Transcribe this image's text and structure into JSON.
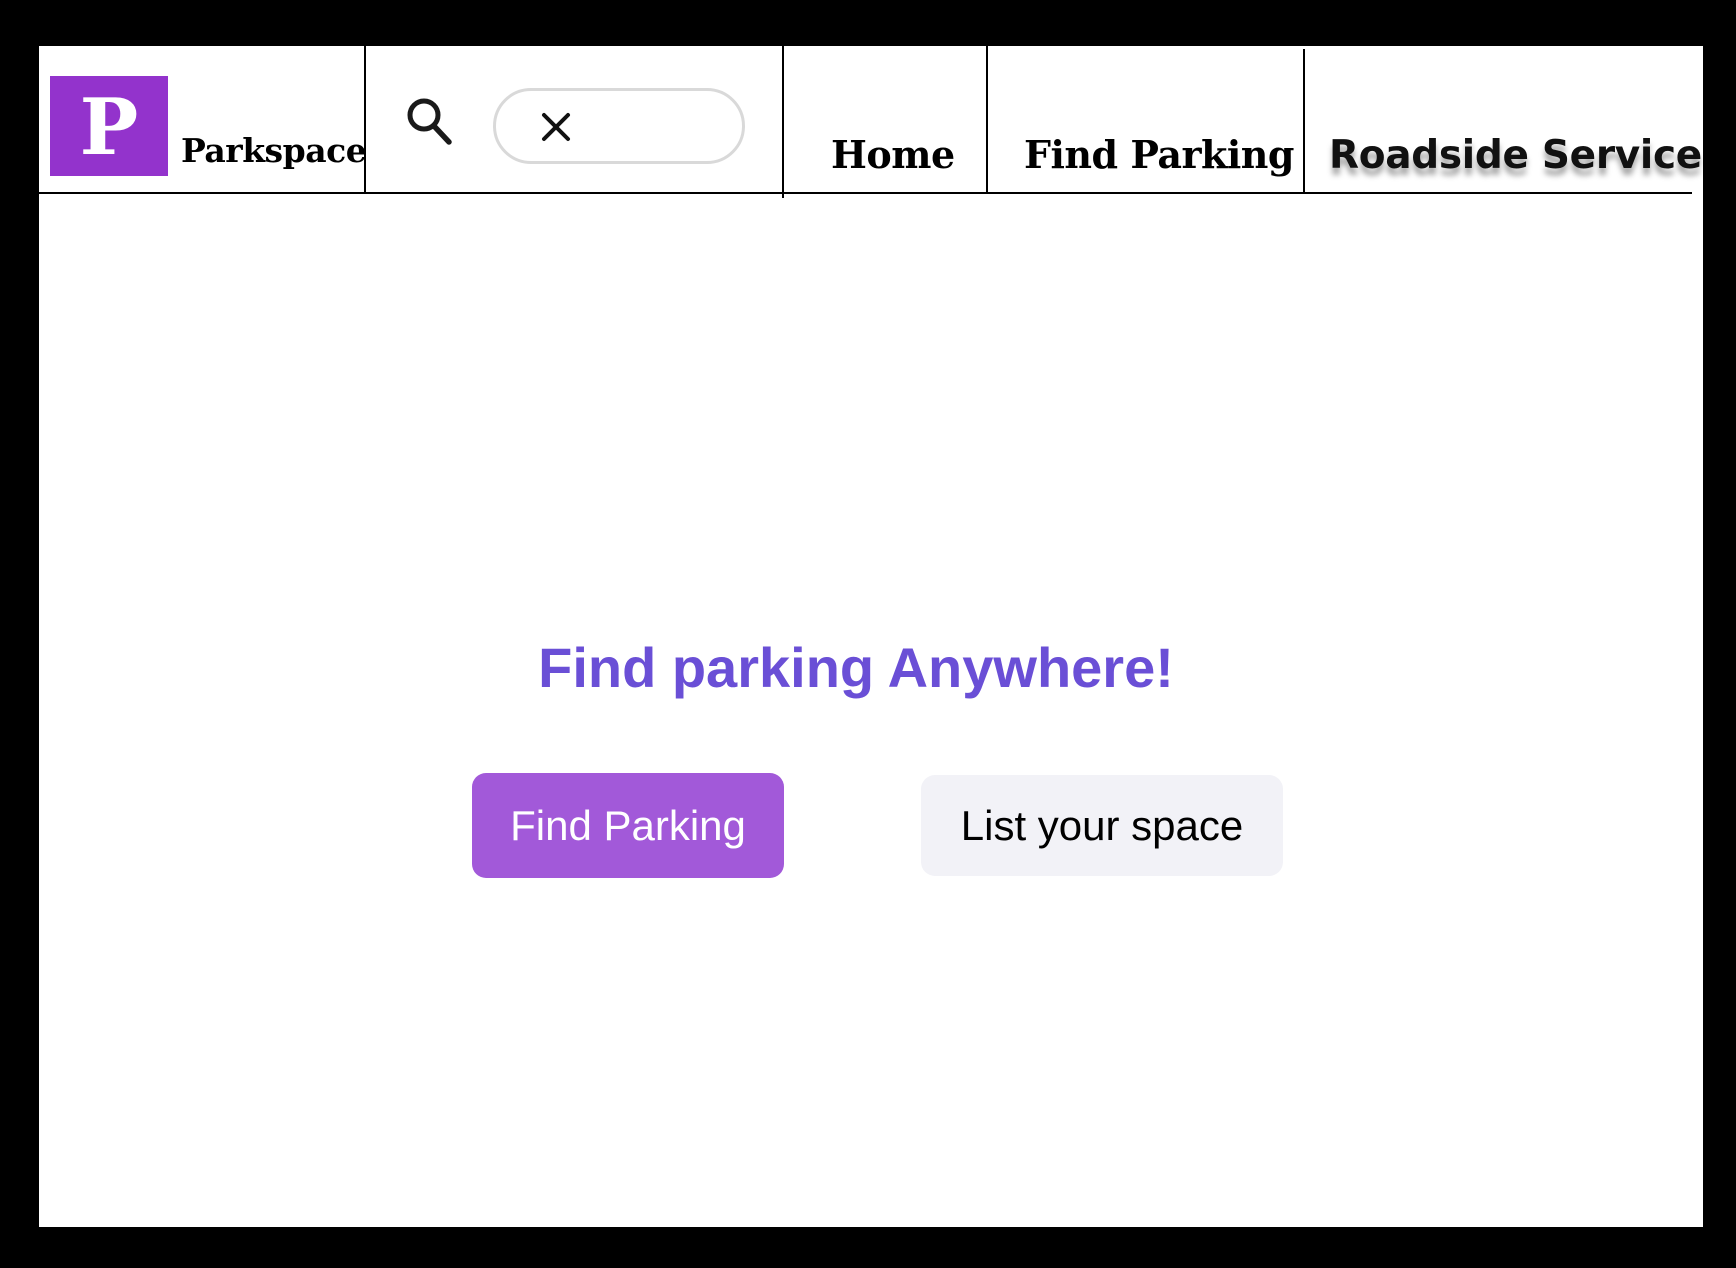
{
  "brand": {
    "logo_letter": "P",
    "name": "Parkspace",
    "logo_color": "#9333cc"
  },
  "search": {
    "icon": "search-icon",
    "clear_icon": "close-icon",
    "value": ""
  },
  "nav": {
    "items": [
      {
        "label": "Home"
      },
      {
        "label": "Find Parking"
      },
      {
        "label": "Roadside Service"
      }
    ]
  },
  "hero": {
    "title": "Find parking Anywhere!",
    "title_color": "#6a4fd6",
    "primary_button": "Find Parking",
    "primary_color": "#a259d9",
    "secondary_button": "List your space",
    "secondary_color": "#f2f2f7"
  }
}
